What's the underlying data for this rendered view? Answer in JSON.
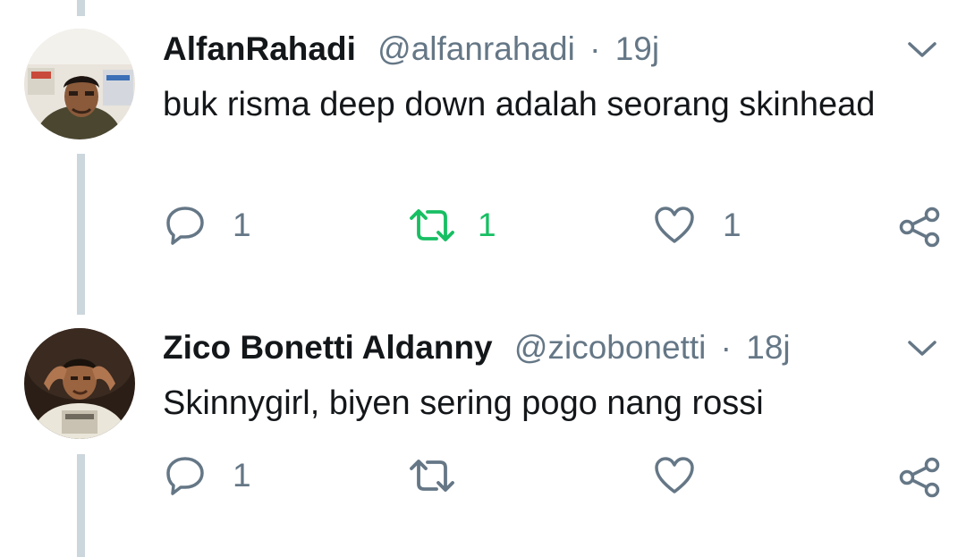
{
  "tweets": [
    {
      "display_name": "AlfanRahadi",
      "handle": "@alfanrahadi",
      "separator": "·",
      "time": "19j",
      "text": "buk risma deep down adalah seorang skinhead",
      "reply_count": "1",
      "retweet_count": "1",
      "like_count": "1",
      "retweeted": true
    },
    {
      "display_name": "Zico Bonetti Aldanny",
      "handle": "@zicobonetti",
      "separator": "·",
      "time": "18j",
      "text": "Skinnygirl, biyen sering pogo nang rossi",
      "reply_count": "1",
      "retweet_count": "",
      "like_count": "",
      "retweeted": false
    }
  ],
  "icons": {
    "reply": "reply-icon",
    "retweet": "retweet-icon",
    "like": "heart-icon",
    "share": "share-icon",
    "menu": "chevron-down-icon"
  },
  "colors": {
    "text": "#14171a",
    "secondary": "#657786",
    "retweet_active": "#17bf63",
    "thread_line": "#ccd6dd"
  }
}
